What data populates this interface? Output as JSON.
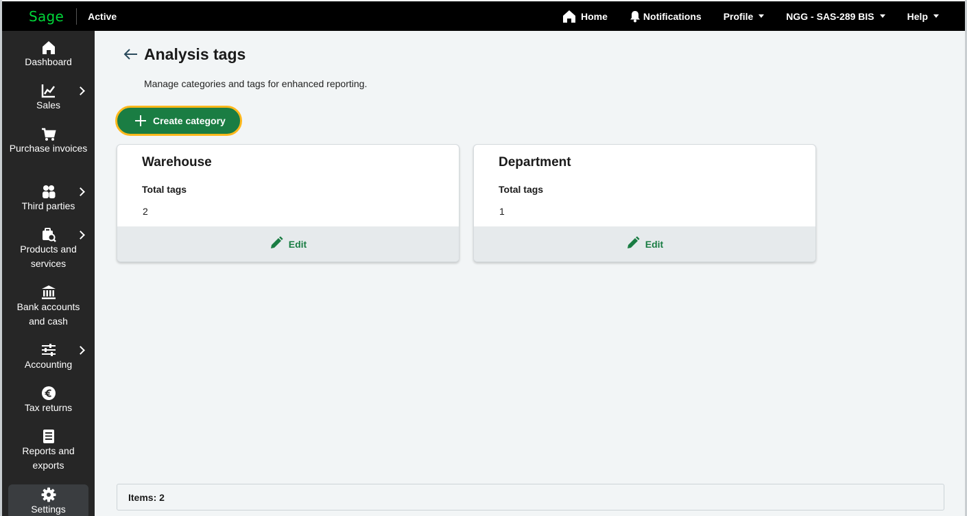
{
  "app": {
    "brand": "Sage",
    "status": "Active",
    "brand_color": "#00d639",
    "accent": "#1a7d43",
    "focus_ring": "#ffb81c"
  },
  "topnav": {
    "home": "Home",
    "notifications": "Notifications",
    "profile": "Profile",
    "company": "NGG - SAS-289 BIS",
    "help": "Help"
  },
  "sidebar": {
    "items": [
      {
        "label": "Dashboard",
        "icon": "home-icon",
        "chevron": false
      },
      {
        "label": "Sales",
        "icon": "chart-line-icon",
        "chevron": true
      },
      {
        "label": "Purchase invoices",
        "icon": "cart-icon",
        "chevron": false
      },
      {
        "label": "Third parties",
        "icon": "people-icon",
        "chevron": true
      },
      {
        "label": "Products and services",
        "icon": "product-search-icon",
        "chevron": true
      },
      {
        "label": "Bank accounts and cash",
        "icon": "bank-icon",
        "chevron": false
      },
      {
        "label": "Accounting",
        "icon": "sliders-icon",
        "chevron": true
      },
      {
        "label": "Tax returns",
        "icon": "euro-icon",
        "chevron": false
      },
      {
        "label": "Reports and exports",
        "icon": "report-icon",
        "chevron": false
      },
      {
        "label": "Settings",
        "icon": "gear-icon",
        "chevron": false,
        "active": true
      }
    ]
  },
  "page": {
    "title": "Analysis tags",
    "subtitle": "Manage categories and tags for enhanced reporting.",
    "create_button": "Create category"
  },
  "categories": [
    {
      "name": "Warehouse",
      "total_label": "Total tags",
      "total": "2",
      "edit_label": "Edit"
    },
    {
      "name": "Department",
      "total_label": "Total tags",
      "total": "1",
      "edit_label": "Edit"
    }
  ],
  "footer": {
    "items_text": "Items: 2"
  }
}
